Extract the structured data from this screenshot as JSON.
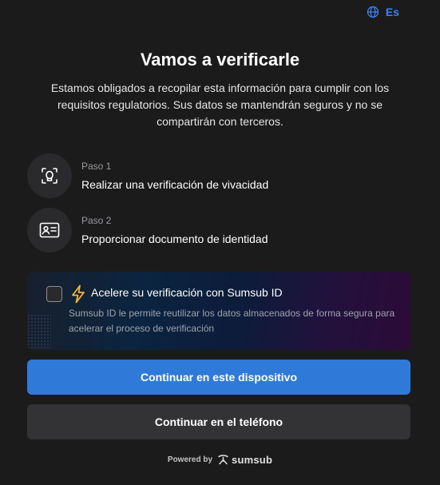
{
  "language": {
    "code": "Es",
    "icon": "globe-icon",
    "color": "#3b82f6"
  },
  "title": "Vamos a verificarle",
  "subtitle": "Estamos obligados a recopilar esta información para cumplir con los requisitos regulatorios. Sus datos se mantendrán seguros y no se compartirán con terceros.",
  "steps": [
    {
      "label": "Paso 1",
      "text": "Realizar una verificación de vivacidad",
      "icon": "face-scan-icon"
    },
    {
      "label": "Paso 2",
      "text": "Proporcionar documento de identidad",
      "icon": "id-card-icon"
    }
  ],
  "promo": {
    "checked": false,
    "icon": "lightning-icon",
    "title": "Acelere su verificación con Sumsub ID",
    "description": "Sumsub ID le permite reutilizar los datos almacenados de forma segura para acelerar el proceso de verificación"
  },
  "buttons": {
    "primary": "Continuar en este dispositivo",
    "secondary": "Continuar en el teléfono"
  },
  "footer": {
    "powered_by": "Powered by",
    "brand": "sumsub",
    "brand_icon": "sumsub-logo-icon"
  },
  "colors": {
    "accent": "#2f7ad8",
    "background": "#1b1b1c",
    "bolt": "#f5b731"
  }
}
